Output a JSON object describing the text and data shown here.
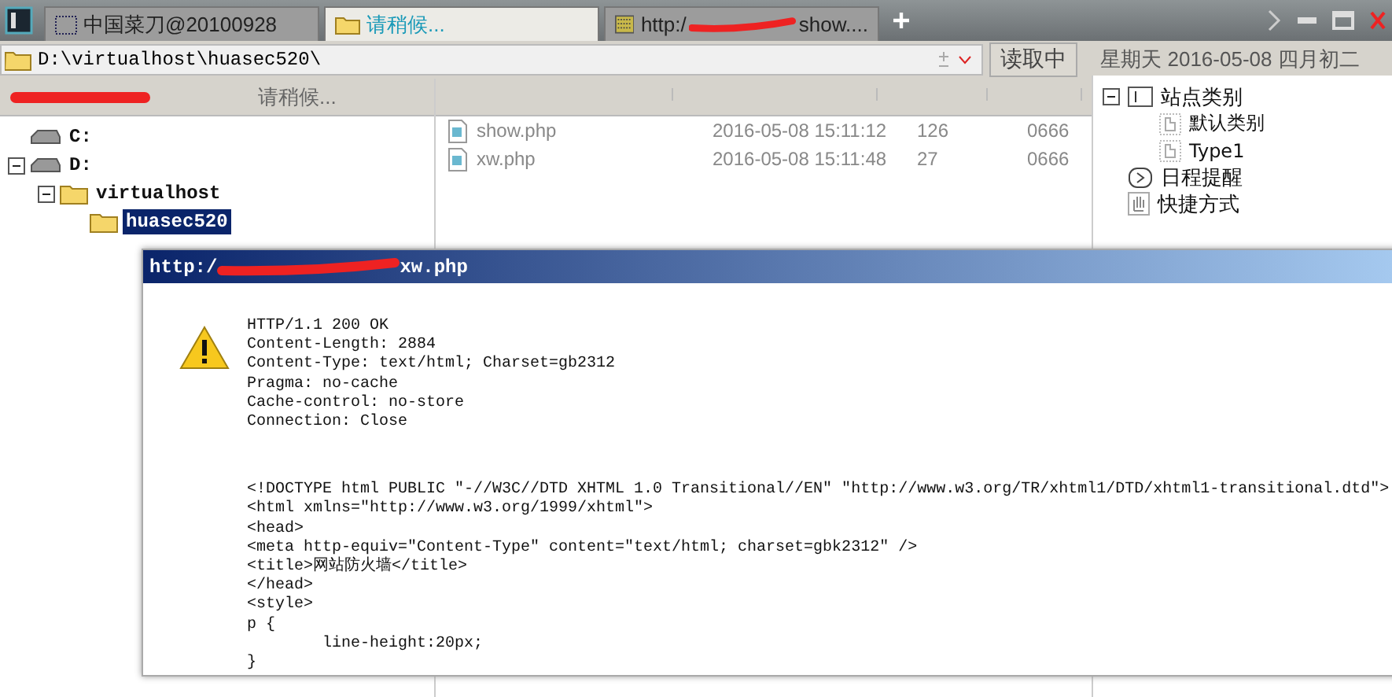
{
  "tabs": [
    {
      "kind": "app",
      "label": "中国菜刀@20100928",
      "selected": false
    },
    {
      "kind": "folder",
      "label": "请稍候...",
      "selected": true
    },
    {
      "kind": "web",
      "label_start": "http:/",
      "label_end": "show....",
      "selected": false
    }
  ],
  "path": "D:\\virtualhost\\huasec520\\",
  "read_button": "读取中",
  "date": "星期天 2016-05-08 四月初二",
  "status": "请稍候...",
  "tree": [
    {
      "kind": "drive",
      "label": "C:",
      "selected": false
    },
    {
      "kind": "drive",
      "label": "D:",
      "selected": false,
      "children": [
        {
          "kind": "folder",
          "label": "virtualhost",
          "selected": false,
          "children": [
            {
              "kind": "folder",
              "label": "huasec520",
              "selected": true
            }
          ]
        }
      ]
    }
  ],
  "files": [
    {
      "name": "show.php",
      "modified": "2016-05-08 15:11:12",
      "size": "126",
      "mode": "0666"
    },
    {
      "name": "xw.php",
      "modified": "2016-05-08 15:11:48",
      "size": "27",
      "mode": "0666"
    }
  ],
  "side": [
    {
      "kind": "category",
      "label": "站点类别",
      "children": [
        {
          "kind": "page",
          "label": "默认类别"
        },
        {
          "kind": "page",
          "label": "Type1"
        }
      ]
    },
    {
      "kind": "clock",
      "label": "日程提醒"
    },
    {
      "kind": "hand",
      "label": "快捷方式"
    }
  ],
  "dialog": {
    "title_start": "http:/",
    "title_end": "xw.php",
    "headers": [
      "HTTP/1.1 200 OK",
      "Content-Length: 2884",
      "Content-Type: text/html; Charset=gb2312",
      "Pragma: no-cache",
      "Cache-control: no-store",
      "Connection: Close"
    ],
    "body": [
      "<!DOCTYPE html PUBLIC \"-//W3C//DTD XHTML 1.0 Transitional//EN\" \"http://www.w3.org/TR/xhtml1/DTD/xhtml1-transitional.dtd\">",
      "<html xmlns=\"http://www.w3.org/1999/xhtml\">",
      "<head>",
      "<meta http-equiv=\"Content-Type\" content=\"text/html; charset=gbk2312\" />",
      "<title>网站防火墙</title>",
      "</head>",
      "<style>",
      "p {",
      "        line-height:20px;",
      "}"
    ]
  }
}
